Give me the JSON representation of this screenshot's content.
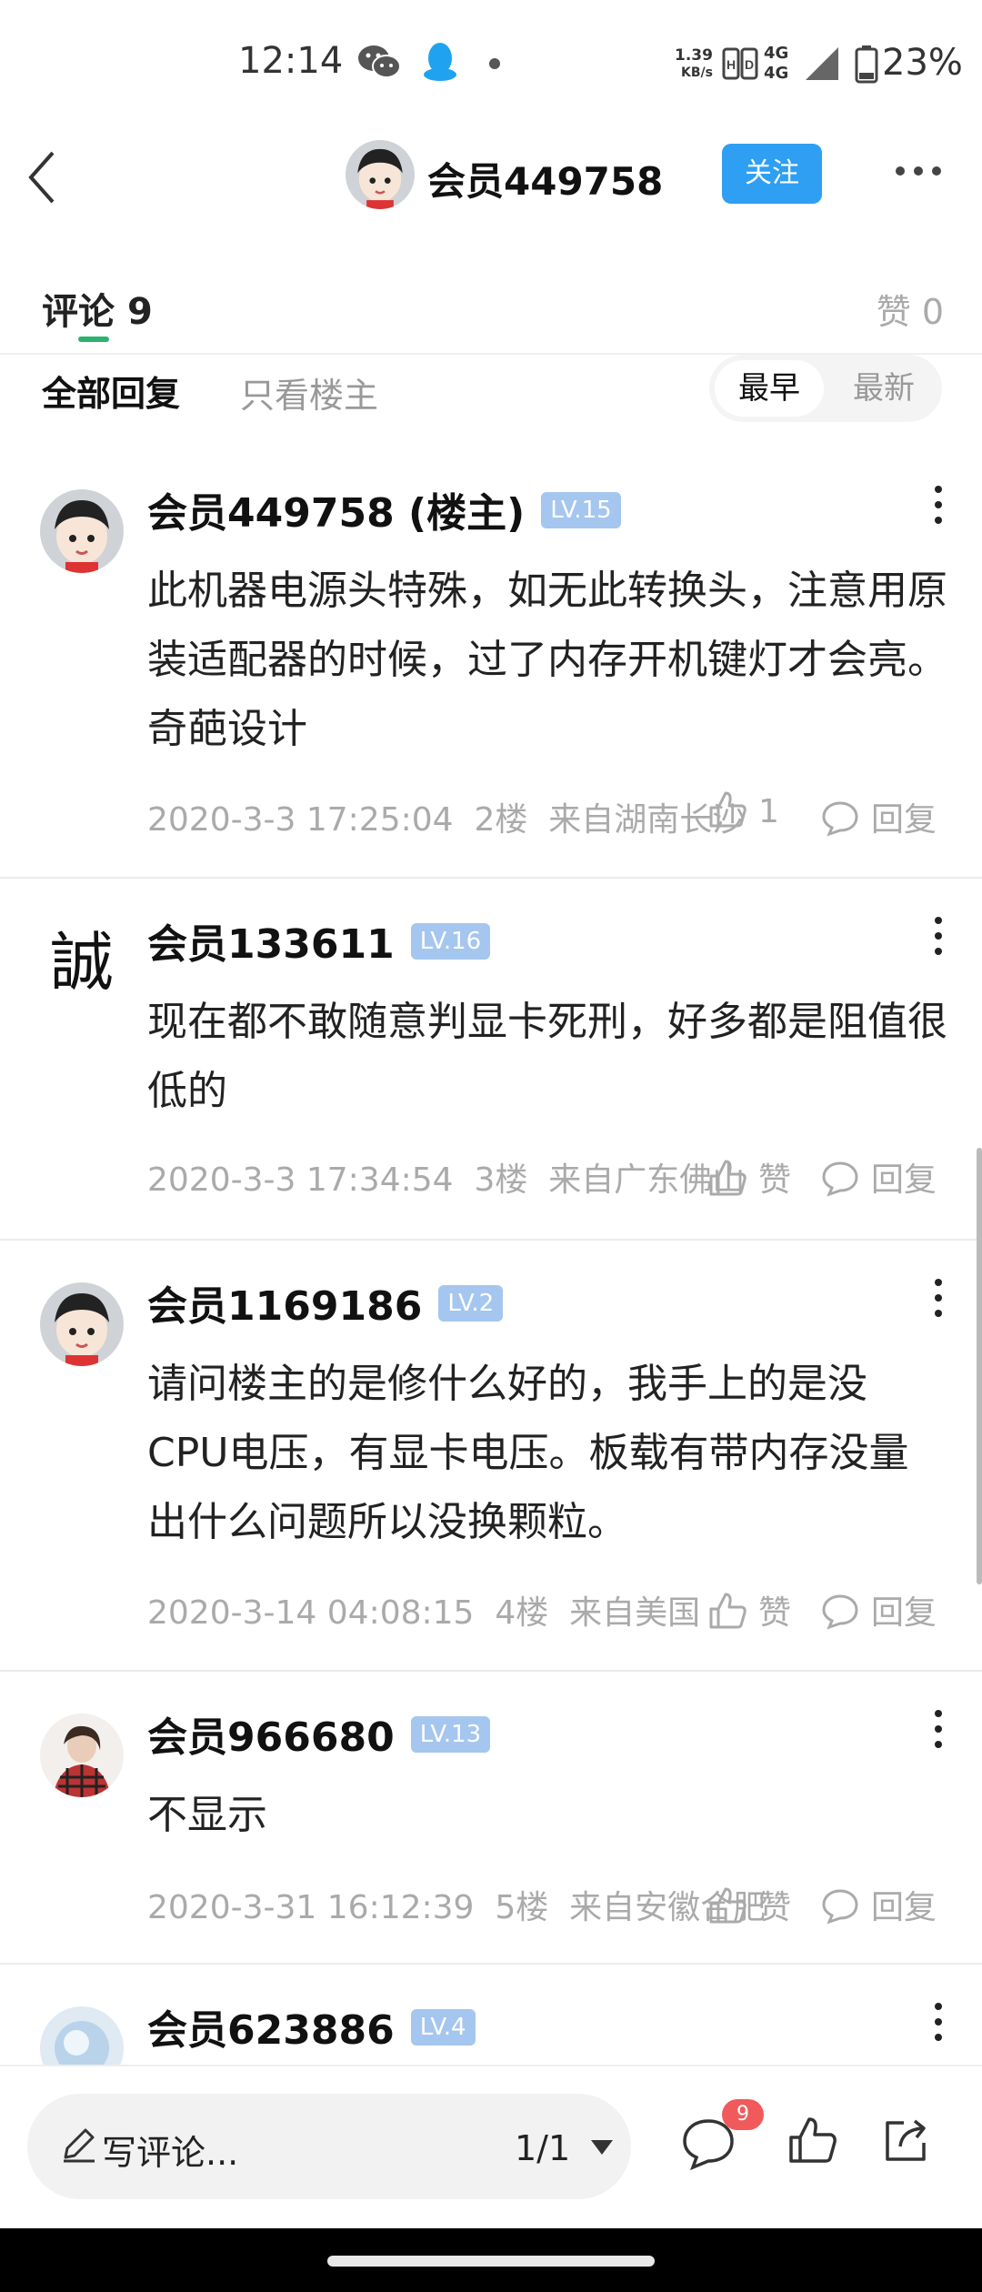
{
  "status_bar": {
    "time": "12:14",
    "net_speed_value": "1.39",
    "net_speed_unit": "KB/s",
    "network_1": "4G",
    "network_2": "4G",
    "battery": "23%",
    "icons": [
      "wechat-icon",
      "qq-icon",
      "hd-icon",
      "signal-icon",
      "battery-icon"
    ]
  },
  "header": {
    "username": "会员449758",
    "follow_label": "关注"
  },
  "tabs": {
    "comments_label": "评论",
    "comments_count": "9",
    "likes_label": "赞",
    "likes_count": "0"
  },
  "filter": {
    "all_replies": "全部回复",
    "only_op": "只看楼主",
    "sort_earliest": "最早",
    "sort_newest": "最新"
  },
  "comments": [
    {
      "name": "会员449758 (楼主)",
      "level": "LV.15",
      "text": "此机器电源头特殊，如无此转换头，注意用原装适配器的时候，过了内存开机键灯才会亮。奇葩设计",
      "time": "2020-3-3 17:25:04",
      "floor": "2楼",
      "from": "来自湖南长沙",
      "likes": "1",
      "reply": "回复"
    },
    {
      "name": "会员133611",
      "level": "LV.16",
      "text": "现在都不敢随意判显卡死刑，好多都是阻值很低的",
      "time": "2020-3-3 17:34:54",
      "floor": "3楼",
      "from": "来自广东佛山",
      "likes": "赞",
      "reply": "回复",
      "avatar_char": "誠"
    },
    {
      "name": "会员1169186",
      "level": "LV.2",
      "text": "请问楼主的是修什么好的，我手上的是没CPU电压，有显卡电压。板载有带内存没量出什么问题所以没换颗粒。",
      "time": "2020-3-14 04:08:15",
      "floor": "4楼",
      "from": "来自美国",
      "likes": "赞",
      "reply": "回复"
    },
    {
      "name": "会员966680",
      "level": "LV.13",
      "text": "不显示",
      "time": "2020-3-31 16:12:39",
      "floor": "5楼",
      "from": "来自安徽合肥",
      "likes": "赞",
      "reply": "回复"
    },
    {
      "name": "会员623886",
      "level": "LV.4"
    }
  ],
  "bottom_bar": {
    "input_placeholder": "写评论...",
    "page_indicator": "1/1",
    "comment_badge": "9"
  },
  "colors": {
    "accent_blue": "#2e9ff2",
    "tab_underline": "#2ab36f",
    "level_badge": "#a5c6ee",
    "notification_red": "#f05a5a"
  }
}
